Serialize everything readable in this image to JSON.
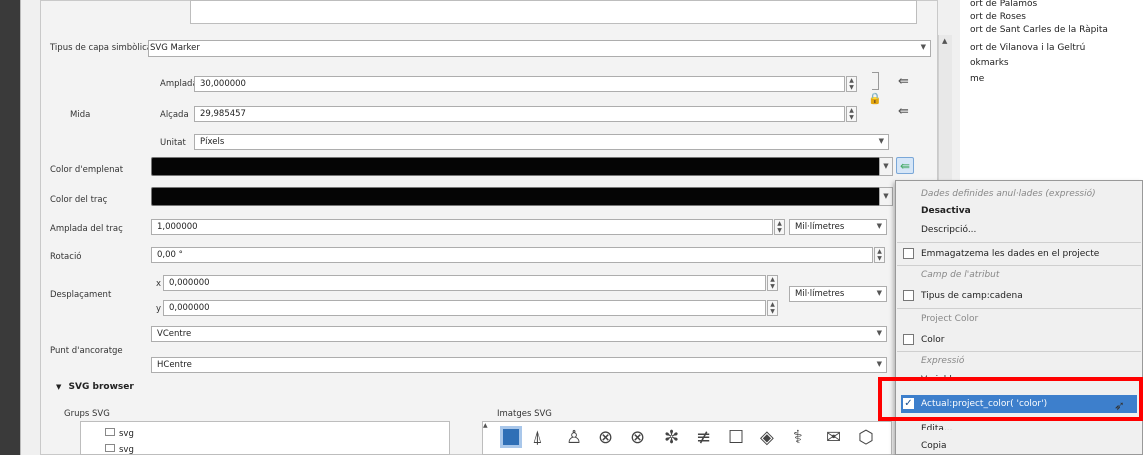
{
  "layer_type": {
    "label": "Tipus de capa simbòlica",
    "value": "SVG Marker"
  },
  "size": {
    "group_label": "Mida",
    "width_label": "Amplada",
    "width_value": "30,000000",
    "height_label": "Alçada",
    "height_value": "29,985457",
    "unit_label": "Unitat",
    "unit_value": "Píxels"
  },
  "fill_color_label": "Color d'emplenat",
  "stroke_color_label": "Color del traç",
  "stroke_width": {
    "label": "Amplada del traç",
    "value": "1,000000",
    "unit": "Mil·límetres"
  },
  "rotation": {
    "label": "Rotació",
    "value": "0,00 °"
  },
  "offset": {
    "label": "Desplaçament",
    "x_label": "x",
    "x_value": "0,000000",
    "y_label": "y",
    "y_value": "0,000000",
    "unit": "Mil·límetres"
  },
  "anchor": {
    "label": "Punt d'ancoratge",
    "v_value": "VCentre",
    "h_value": "HCentre"
  },
  "svg_browser": {
    "title": "SVG browser",
    "groups_label": "Grups SVG",
    "images_label": "Imatges SVG",
    "groups": [
      "svg",
      "svg"
    ]
  },
  "toc": {
    "items": [
      "ort de Palamós",
      "ort de Roses",
      "ort de Sant Carles de la Ràpita",
      "ort de Vilanova i la Geltrú",
      "okmarks",
      "me"
    ]
  },
  "context_menu": {
    "header": "Dades definides anul·lades (expressió)",
    "deactivate": "Desactiva",
    "description": "Descripció...",
    "store_data": "Emmagatzema les dades en el projecte",
    "attr_field_header": "Camp de l'atribut",
    "field_type": "Tipus de camp:cadena",
    "project_color_header": "Project Color",
    "color": "Color",
    "expression_header": "Expressió",
    "variable": "Variable",
    "current": "Actual:project_color( 'color')",
    "edit": "Edita...",
    "copy": "Copia"
  }
}
